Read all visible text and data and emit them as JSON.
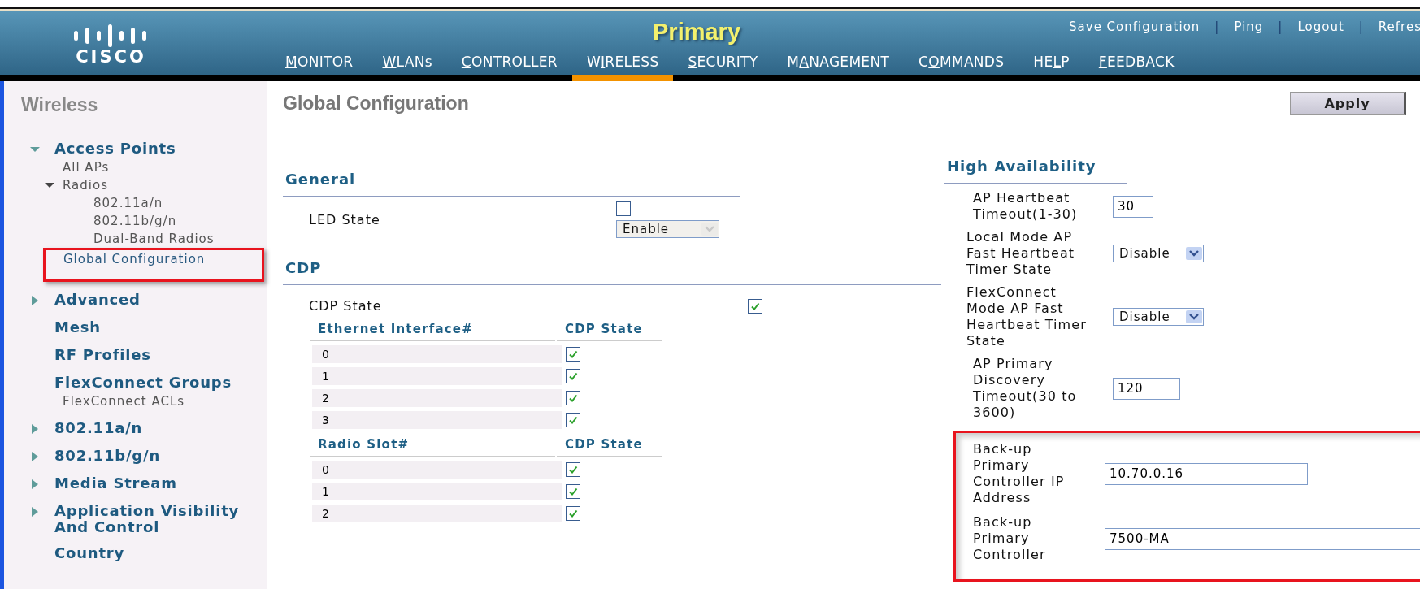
{
  "header": {
    "logo": "CISCO",
    "title": "Primary",
    "separator": "|",
    "links": [
      {
        "label": {
          "before": "Sa",
          "key": "v",
          "after": "e Configuration"
        }
      },
      {
        "label": {
          "key": "P",
          "after": "ing"
        }
      },
      {
        "label": {
          "before": "Lo",
          "key": "g",
          "after": "out"
        }
      },
      {
        "label": {
          "key": "R",
          "after": "efres"
        }
      }
    ],
    "nav": [
      {
        "label": {
          "key": "M",
          "after": "ONITOR"
        },
        "selected": false
      },
      {
        "label": {
          "key": "W",
          "after": "LANs"
        },
        "selected": false
      },
      {
        "label": {
          "key": "C",
          "after": "ONTROLLER"
        },
        "selected": false
      },
      {
        "label": {
          "before": "W",
          "key": "I",
          "after": "RELESS"
        },
        "selected": true
      },
      {
        "label": {
          "key": "S",
          "after": "ECURITY"
        },
        "selected": false
      },
      {
        "label": {
          "before": "M",
          "key": "A",
          "after": "NAGEMENT"
        },
        "selected": false
      },
      {
        "label": {
          "before": "C",
          "key": "O",
          "after": "MMANDS"
        },
        "selected": false
      },
      {
        "label": {
          "before": "HE",
          "key": "L",
          "after": "P"
        },
        "selected": false
      },
      {
        "label": {
          "key": "F",
          "after": "EEDBACK"
        },
        "selected": false
      }
    ]
  },
  "sidebar": {
    "title": "Wireless",
    "items": [
      {
        "label": "Access Points",
        "expanded": true,
        "children": [
          {
            "label": "All APs"
          },
          {
            "label": "Radios",
            "expanded": true,
            "children": [
              {
                "label": "802.11a/n"
              },
              {
                "label": "802.11b/g/n"
              },
              {
                "label": "Dual-Band Radios"
              }
            ]
          },
          {
            "label": "Global Configuration",
            "highlighted": true
          }
        ]
      },
      {
        "label": "Advanced",
        "expanded": false
      },
      {
        "label": "Mesh"
      },
      {
        "label": "RF Profiles"
      },
      {
        "label": "FlexConnect Groups",
        "children": [
          {
            "label": "FlexConnect ACLs"
          }
        ]
      },
      {
        "label": "802.11a/n",
        "expanded": false
      },
      {
        "label": "802.11b/g/n",
        "expanded": false
      },
      {
        "label": "Media Stream",
        "expanded": false
      },
      {
        "label": "Application Visibility And Control",
        "expanded": false
      },
      {
        "label": "Country"
      }
    ]
  },
  "page": {
    "title": "Global Configuration",
    "apply": "Apply"
  },
  "general": {
    "heading": "General",
    "led": {
      "label": "LED State",
      "checked": false,
      "select": {
        "value": "Enable",
        "disabled": true
      }
    }
  },
  "cdp": {
    "heading": "CDP",
    "state": {
      "label": "CDP State",
      "checked": true
    },
    "tables": [
      {
        "columns": [
          "Ethernet Interface#",
          "CDP State"
        ],
        "rows": [
          {
            "slot": "0",
            "checked": true
          },
          {
            "slot": "1",
            "checked": true
          },
          {
            "slot": "2",
            "checked": true
          },
          {
            "slot": "3",
            "checked": true
          }
        ]
      },
      {
        "columns": [
          "Radio Slot#",
          "CDP State"
        ],
        "rows": [
          {
            "slot": "0",
            "checked": true
          },
          {
            "slot": "1",
            "checked": true
          },
          {
            "slot": "2",
            "checked": true
          }
        ]
      }
    ]
  },
  "high_availability": {
    "heading": "High Availability",
    "rows": [
      {
        "kind": "input",
        "label": "AP Heartbeat Timeout(1-30)",
        "value": "30"
      },
      {
        "kind": "select",
        "label": "Local Mode AP Fast Heartbeat Timer State",
        "value": "Disable",
        "disabled": false
      },
      {
        "kind": "select",
        "label": "FlexConnect Mode AP Fast Heartbeat Timer State",
        "value": "Disable",
        "disabled": false
      },
      {
        "kind": "input",
        "label": "AP Primary Discovery Timeout(30 to 3600)",
        "value": "120"
      },
      {
        "kind": "input",
        "label": "Back-up Primary Controller IP Address",
        "value": "10.70.0.16",
        "highlighted": true
      },
      {
        "kind": "input",
        "label": "Back-up Primary Controller",
        "value": "7500-MA",
        "highlighted": true
      }
    ]
  }
}
